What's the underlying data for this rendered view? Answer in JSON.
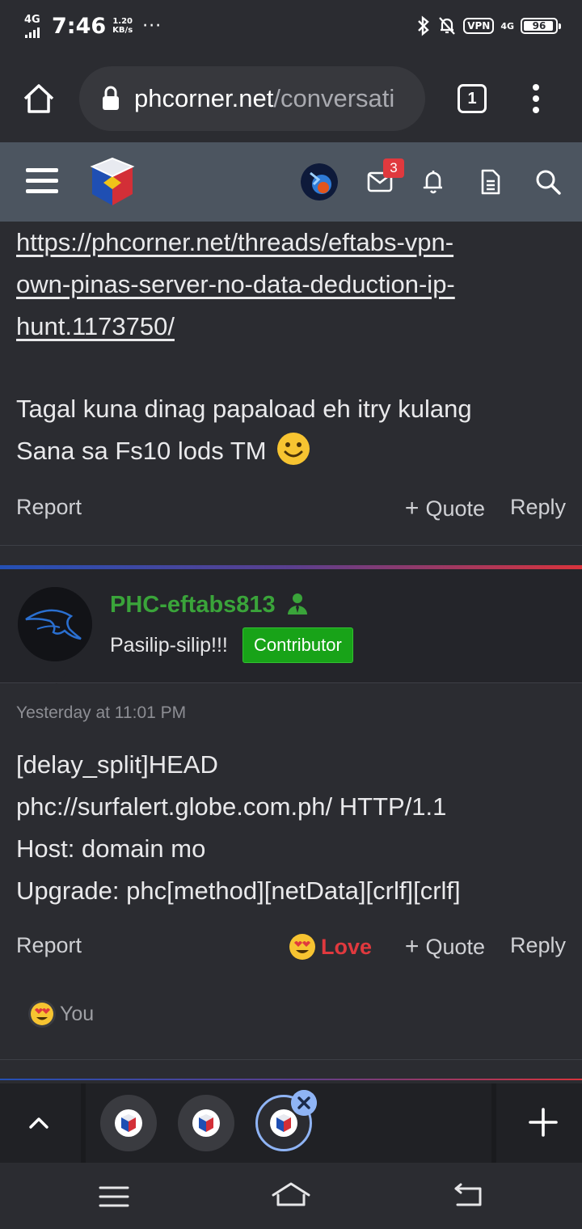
{
  "status_bar": {
    "network": "4G",
    "time": "7:46",
    "speed_value": "1.20",
    "speed_unit": "KB/s",
    "more": "···",
    "vpn": "VPN",
    "network_right": "4G",
    "battery": "96",
    "battery_level": 0.96
  },
  "browser": {
    "url_domain": "phcorner.net",
    "url_path": "/conversati",
    "tab_count": "1"
  },
  "site_header": {
    "alerts_badge": "3"
  },
  "post1": {
    "link_lines": [
      "https://phcorner.net/threads/eftabs-vpn-",
      "own-pinas-server-no-data-deduction-ip-",
      "hunt.1173750/"
    ],
    "message_line1": "Tagal kuna dinag papaload eh itry kulang",
    "message_line2": "Sana sa Fs10 lods TM",
    "report": "Report",
    "quote": "Quote",
    "reply": "Reply"
  },
  "post2": {
    "username": "PHC-eftabs813",
    "user_title": "Pasilip-silip!!!",
    "role_badge": "Contributor",
    "timestamp": "Yesterday at 11:01 PM",
    "lines": [
      "[delay_split]HEAD",
      "phc://surfalert.globe.com.ph/ HTTP/1.1",
      "Host: domain mo",
      "Upgrade: phc[method][netData][crlf][crlf]"
    ],
    "report": "Report",
    "love": "Love",
    "quote": "Quote",
    "reply": "Reply",
    "reaction_by": "You"
  },
  "colors": {
    "background": "#2b2c31",
    "site_header": "#4c5560",
    "username_green": "#3aa43a",
    "badge_green": "#18a318",
    "love_red": "#e0393e",
    "active_tab_ring": "#8fb4f5"
  }
}
